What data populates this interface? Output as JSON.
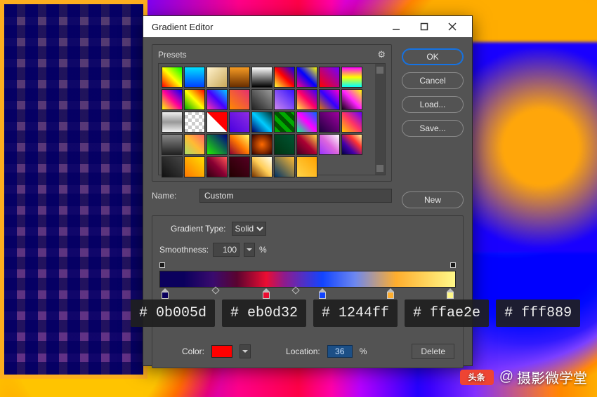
{
  "window": {
    "title": "Gradient Editor"
  },
  "buttons": {
    "ok": "OK",
    "cancel": "Cancel",
    "load": "Load...",
    "save": "Save...",
    "new": "New",
    "delete": "Delete"
  },
  "labels": {
    "presets": "Presets",
    "name": "Name:",
    "gradient_type": "Gradient Type:",
    "smoothness": "Smoothness:",
    "color": "Color:",
    "location": "Location:",
    "percent": "%"
  },
  "fields": {
    "name_value": "Custom",
    "gradient_type_value": "Solid",
    "smoothness_value": "100",
    "location_value": "36"
  },
  "presets": [
    "linear-gradient(45deg,#ff0000,#ffff00,#00ff00)",
    "linear-gradient(180deg,#00e0ff,#0040ff)",
    "linear-gradient(135deg,#fff2cc,#caa85a)",
    "linear-gradient(180deg,#f59a23,#6a2e00)",
    "linear-gradient(180deg,#ffffff,#000000)",
    "linear-gradient(45deg,#ff3,#f00,#00f)",
    "linear-gradient(45deg,#ff0080,#00f,#ff0)",
    "linear-gradient(45deg,#f00,#7000ff)",
    "linear-gradient(180deg,#f0f,#ff0,#0ff)",
    "linear-gradient(45deg,#ff0,#f09,#00f)",
    "linear-gradient(45deg,#0a0,#ff0,#f00)",
    "linear-gradient(45deg,#f3a,#40f,#0cf)",
    "linear-gradient(45deg,#ff8a00,#e52e71)",
    "linear-gradient(45deg,#222,#999)",
    "linear-gradient(45deg,#c8e,#31f)",
    "linear-gradient(45deg,#ffec3d,#ff0066,#3300ff)",
    "linear-gradient(45deg,#d70,#30f,#f0c)",
    "linear-gradient(45deg,#101,#f2f,#ff0)",
    "linear-gradient(180deg,#eee,#999,#eee)",
    "repeating-conic-gradient(#ccc 0 25%,#fff 0 50%) 0/10px 10px",
    "linear-gradient(45deg,#fff 49%,#f00 51%)",
    "linear-gradient(45deg,#4a00e0,#8e2de2)",
    "linear-gradient(45deg,#006,#0cf,#033)",
    "repeating-linear-gradient(45deg,#0a0 0 6px,#050 6px 12px)",
    "linear-gradient(45deg,#0f8,#f0f,#06f)",
    "linear-gradient(45deg,#200040,#a000a0)",
    "linear-gradient(45deg,#fc0,#f36,#60f)",
    "linear-gradient(180deg,#888,#222)",
    "linear-gradient(45deg,#ad6,#fb3,#f66)",
    "linear-gradient(45deg,#2e0,#008)",
    "linear-gradient(45deg,#803,#f70,#ff6)",
    "radial-gradient(circle,#ff6a00,#300)",
    "linear-gradient(45deg,#031,#053)",
    "linear-gradient(45deg,#402,#a03,#fd4)",
    "linear-gradient(45deg,#93f,#d6d,#fff)",
    "linear-gradient(45deg,#004,#40a,#f33,#ff9)",
    "linear-gradient(45deg,#111,#444)",
    "linear-gradient(45deg,#f70,#fd0)",
    "linear-gradient(45deg,#301,#803,#f55)",
    "linear-gradient(45deg,#200,#502)",
    "linear-gradient(45deg,#730,#fc5,#ffe)",
    "linear-gradient(45deg,#036,#fb3)",
    "linear-gradient(45deg,#ffd54a,#ffa200)"
  ],
  "gradient_stops": [
    {
      "hex": "# 0b005d",
      "color": "#0b005d",
      "pos": 2
    },
    {
      "hex": "# eb0d32",
      "color": "#eb0d32",
      "pos": 36
    },
    {
      "hex": "# 1244ff",
      "color": "#1244ff",
      "pos": 55
    },
    {
      "hex": "# ffae2e",
      "color": "#ffae2e",
      "pos": 78
    },
    {
      "hex": "# fff889",
      "color": "#fff889",
      "pos": 98
    }
  ],
  "midpoints": [
    19,
    46
  ],
  "active_stop_color": "#ff0000",
  "watermark": {
    "badge": "头条",
    "at": "@",
    "name": "摄影微学堂"
  }
}
